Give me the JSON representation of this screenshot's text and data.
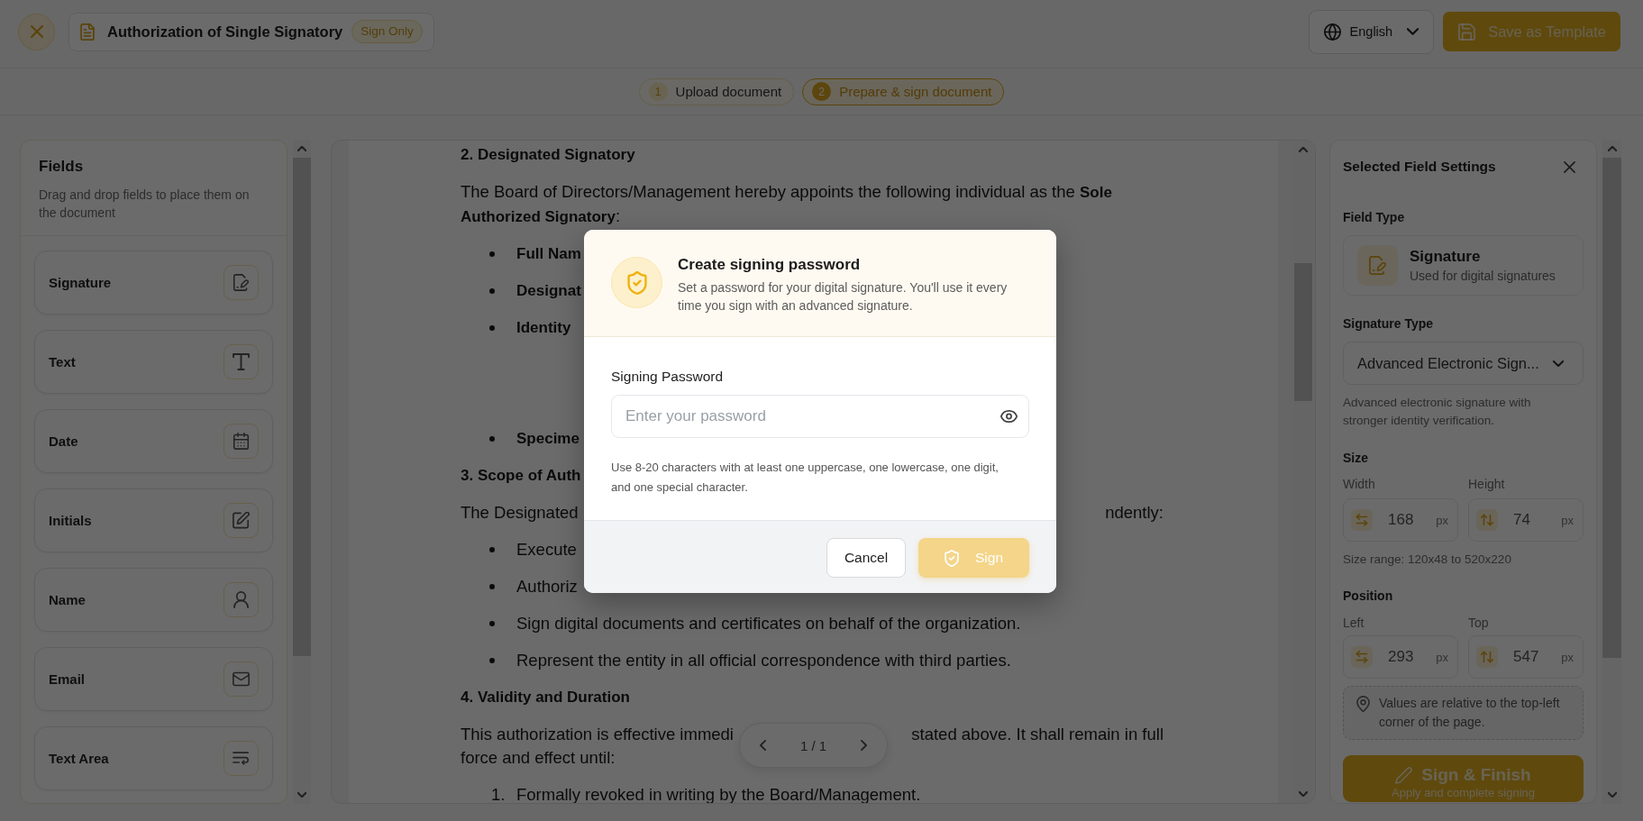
{
  "header": {
    "title": "Authorization of Single Signatory",
    "badge": "Sign Only",
    "language": "English",
    "save_button": "Save as Template"
  },
  "steps": [
    {
      "number": "1",
      "label": "Upload document",
      "selected": false
    },
    {
      "number": "2",
      "label": "Prepare & sign document",
      "selected": true
    }
  ],
  "fields_panel": {
    "title": "Fields",
    "subtitle": "Drag and drop fields to place them on the document",
    "items": [
      {
        "label": "Signature",
        "kind": "signature"
      },
      {
        "label": "Text",
        "kind": "text"
      },
      {
        "label": "Date",
        "kind": "date"
      },
      {
        "label": "Initials",
        "kind": "initials"
      },
      {
        "label": "Name",
        "kind": "name"
      },
      {
        "label": "Email",
        "kind": "email"
      },
      {
        "label": "Text Area",
        "kind": "textarea"
      }
    ]
  },
  "document": {
    "blocks": [
      {
        "kind": "heading",
        "text": "2. Designated Signatory"
      },
      {
        "kind": "paragraph",
        "text": "The Board of Directors/Management hereby appoints the following individual as the **Sole Authorized Signatory**:"
      },
      {
        "kind": "bullet_label",
        "text": "Full Nam"
      },
      {
        "kind": "bullet_label",
        "text": "Designat"
      },
      {
        "kind": "bullet_label",
        "text": "Identity"
      },
      {
        "kind": "space"
      },
      {
        "kind": "bullet_label",
        "text": "Specime"
      },
      {
        "kind": "heading",
        "text": "3. Scope of Auth"
      },
      {
        "kind": "covered_paragraph",
        "lines": [
          [
            "The Designated",
            "ndently:"
          ]
        ]
      },
      {
        "kind": "bullet",
        "text": "Execute"
      },
      {
        "kind": "bullet",
        "text": "Authoriz"
      },
      {
        "kind": "bullet",
        "text": "Sign digital documents and certificates on behalf of the organization."
      },
      {
        "kind": "bullet",
        "text": "Represent the entity in all official correspondence with third parties."
      },
      {
        "kind": "heading",
        "text": "4. Validity and Duration"
      },
      {
        "kind": "covered_paragraph",
        "lines": [
          [
            "This authorization is effective immedi",
            "stated above. It shall remain in full"
          ],
          [
            "force and effect until:"
          ]
        ]
      },
      {
        "kind": "numbered",
        "number": "1.",
        "text": "Formally revoked in writing by the Board/Management."
      }
    ],
    "pager": "1 / 1"
  },
  "settings_panel": {
    "title": "Selected Field Settings",
    "field_type_label": "Field Type",
    "field_type": {
      "kind": "signature",
      "name": "Signature",
      "description": "Used for digital signatures"
    },
    "signature_type_label": "Signature Type",
    "signature_type": "Advanced Electronic Sign...",
    "signature_type_help": "Advanced electronic signature with stronger identity verification.",
    "size_label": "Size",
    "size_fields": [
      {
        "label": "Width",
        "value": "168",
        "unit": "px",
        "kind": "horizontal"
      },
      {
        "label": "Height",
        "value": "74",
        "unit": "px",
        "kind": "vertical"
      }
    ],
    "size_range": "Size range: 120x48 to 520x220",
    "position_label": "Position",
    "position_fields": [
      {
        "label": "Left",
        "value": "293",
        "unit": "px",
        "kind": "horizontal"
      },
      {
        "label": "Top",
        "value": "547",
        "unit": "px",
        "kind": "vertical"
      }
    ],
    "position_note": "Values are relative to the top-left corner of the page.",
    "finish_button": {
      "label": "Sign & Finish",
      "sublabel": "Apply and complete signing"
    }
  },
  "dialog": {
    "title": "Create signing password",
    "description": "Set a password for your digital signature. You'll use it every time you sign with an advanced signature.",
    "field_label": "Signing Password",
    "placeholder": "Enter your password",
    "hint": "Use 8-20 characters with at least one uppercase, one lowercase, one digit, and one special character.",
    "buttons": [
      {
        "label": "Cancel",
        "kind": "secondary",
        "disabled": false
      },
      {
        "label": "Sign",
        "kind": "primary",
        "disabled": true
      }
    ]
  }
}
